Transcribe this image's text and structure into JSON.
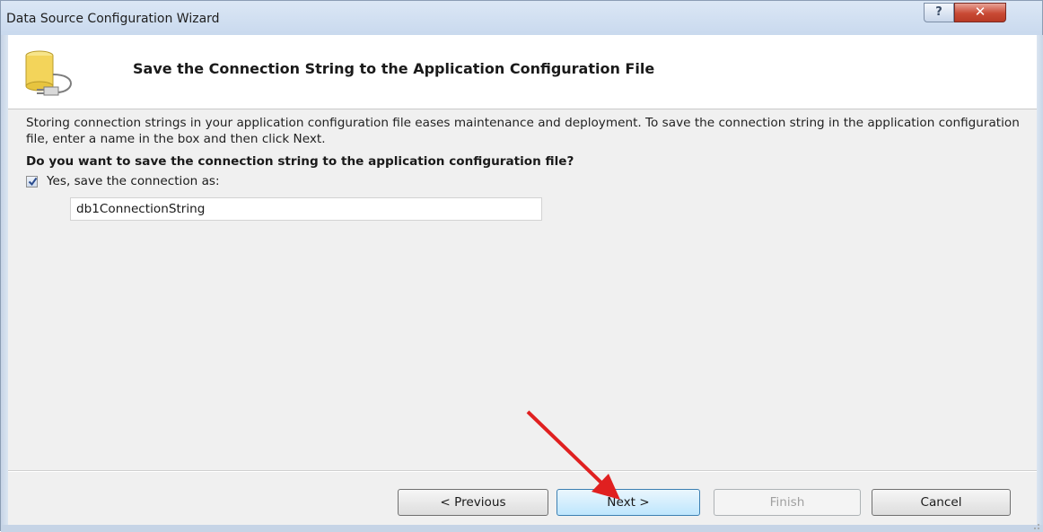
{
  "window": {
    "title": "Data Source Configuration Wizard",
    "help_label": "?",
    "close_label": "✕"
  },
  "header": {
    "title": "Save the Connection String to the Application Configuration File",
    "icon": "database-plug-icon"
  },
  "content": {
    "description": "Storing connection strings in your application configuration file eases maintenance and deployment. To save the connection string in the application configuration file, enter a name in the box and then click Next.",
    "question": "Do you want to save the connection string to the application configuration file?",
    "checkbox": {
      "label": "Yes, save the connection as:",
      "checked": true
    },
    "connection_name": {
      "value": "db1ConnectionString"
    }
  },
  "buttons": {
    "previous": "< Previous",
    "next": "Next >",
    "finish": "Finish",
    "cancel": "Cancel"
  },
  "colors": {
    "annotation_arrow": "#e02020",
    "next_button_focus": "#3c7fb1"
  }
}
